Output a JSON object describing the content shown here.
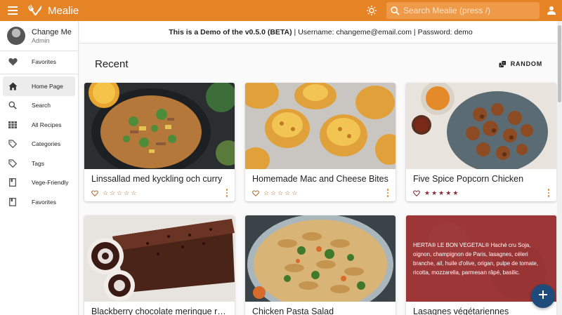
{
  "app": {
    "title": "Mealie"
  },
  "search": {
    "placeholder": "Search Mealie (press /)"
  },
  "colors": {
    "primary": "#e58325",
    "fab": "#1e4b7a",
    "star": "#b06a2c"
  },
  "profile": {
    "name": "Change Me",
    "role": "Admin"
  },
  "sidebar": {
    "items": [
      {
        "label": "Favorites",
        "icon": "heart-icon"
      },
      {
        "label": "Home Page",
        "icon": "home-icon"
      },
      {
        "label": "Search",
        "icon": "search-icon"
      },
      {
        "label": "All Recipes",
        "icon": "grid-icon"
      },
      {
        "label": "Categories",
        "icon": "tag-icon"
      },
      {
        "label": "Tags",
        "icon": "tag-icon"
      },
      {
        "label": "Vege-Friendly",
        "icon": "book-icon"
      },
      {
        "label": "Favorites",
        "icon": "book-icon"
      }
    ]
  },
  "banner": {
    "bold": "This is a Demo of the v0.5.0 (BETA)",
    "rest": " | Username: changeme@email.com | Password: demo"
  },
  "section": {
    "title": "Recent",
    "random_label": "RANDOM"
  },
  "recipes": [
    {
      "title": "Linssallad med kyckling och curry",
      "rating": 0
    },
    {
      "title": "Homemade Mac and Cheese Bites",
      "rating": 0
    },
    {
      "title": "Five Spice Popcorn Chicken",
      "rating": 5
    },
    {
      "title": "Blackberry chocolate meringue roulade",
      "rating": 0
    },
    {
      "title": "Chicken Pasta Salad",
      "rating": 0
    },
    {
      "title": "Lasagnes végétariennes",
      "rating": 0,
      "description": "HERTA® LE BON VEGETAL® Haché cru Soja, oignon, champignon de Paris, lasagnes, céleri branche, ail, huile d'olive, origan, pulpe de tomate, ricotta, mozzarella, parmesan râpé, basilic."
    }
  ]
}
